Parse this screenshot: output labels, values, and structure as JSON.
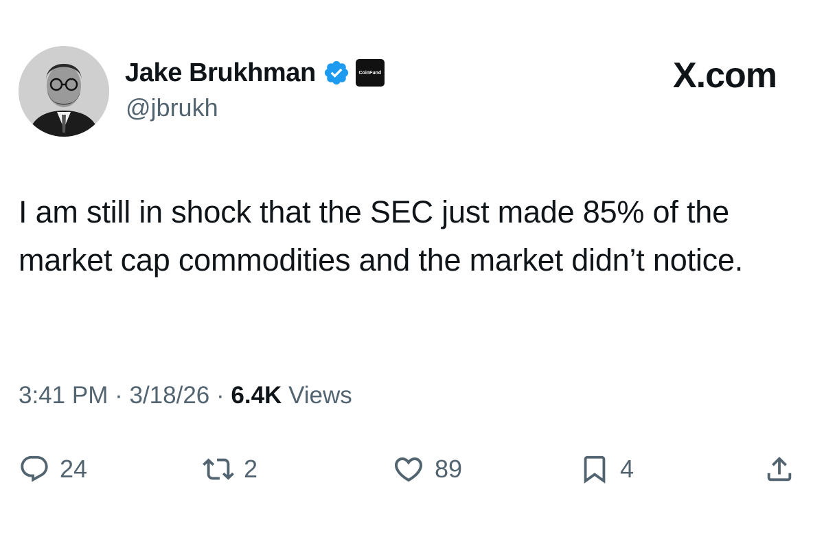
{
  "author": {
    "display_name": "Jake Brukhman",
    "handle": "@jbrukh",
    "affiliate_badge": "CoinFund",
    "verified_color": "#1d9bf0"
  },
  "brand": "X.com",
  "tweet": {
    "text": "I am still in shock that the SEC just made 85% of the market cap commodities and the market didn’t notice.",
    "time": "3:41 PM",
    "date": "3/18/26",
    "views_count": "6.4K",
    "views_label": "Views",
    "separator": "·"
  },
  "actions": {
    "replies": "24",
    "reposts": "2",
    "likes": "89",
    "bookmarks": "4"
  },
  "icons": {
    "reply": "reply-icon",
    "repost": "repost-icon",
    "like": "heart-icon",
    "bookmark": "bookmark-icon",
    "share": "share-icon"
  },
  "colors": {
    "text": "#0f1419",
    "secondary": "#536471",
    "verified": "#1d9bf0"
  }
}
